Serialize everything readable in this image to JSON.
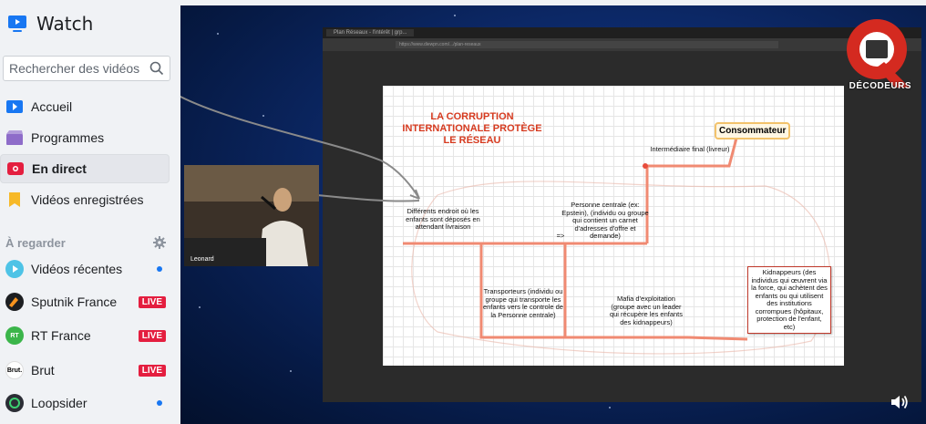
{
  "sidebar": {
    "title": "Watch",
    "search_placeholder": "Rechercher des vidéos",
    "nav": [
      {
        "label": "Accueil"
      },
      {
        "label": "Programmes"
      },
      {
        "label": "En direct"
      },
      {
        "label": "Vidéos enregistrées"
      }
    ],
    "section_label": "À regarder",
    "following": [
      {
        "label": "Vidéos récentes",
        "badge": ""
      },
      {
        "label": "Sputnik France",
        "badge": "LIVE"
      },
      {
        "label": "RT France",
        "badge": "LIVE"
      },
      {
        "label": "Brut",
        "badge": "LIVE"
      },
      {
        "label": "Loopsider",
        "badge": ""
      }
    ],
    "avatar_text": {
      "rt": "RT",
      "brut": "Brut."
    }
  },
  "video": {
    "browser_tab": "Plan Réseaux - l'intérêt | grp...",
    "url": "https://www.diewpn.com/.../plan-reseaux",
    "pip_label": "Leonard",
    "logo_text": "DÉCODEURS"
  },
  "mindmap": {
    "title_lines": [
      "LA CORRUPTION",
      "INTERNATIONALE PROTÈGE",
      "LE RÉSEAU"
    ],
    "consommateur": "Consommateur",
    "intermediaire": "Intermédiaire final (livreur)",
    "personne_centrale": "Personne centrale (ex: Epstein), (individu ou groupe qui contient un carnet d'adresses d'offre et demande)",
    "arrow": "=>",
    "differents": "Différents endroit où les enfants sont déposés en attendant livraison",
    "transporteurs": "Transporteurs (individu ou groupe qui transporte les enfants vers le controle de la Personne centrale)",
    "mafia": "Mafia d'exploitation (groupe avec un leader qui récupère les enfants des kidnappeurs)",
    "kidnappeurs": "Kidnappeurs (des individus qui œuvrent via la force, qui achètent des enfants ou qui utilisent des institutions corrompues (hôpitaux, protection de l'enfant, etc)"
  },
  "colors": {
    "live_red": "#e41e3f",
    "link_blue": "#1877f2",
    "mindmap_line": "#f08a72",
    "title_red": "#d63a1f"
  },
  "icons": [
    "tv-icon",
    "search-icon",
    "home-icon",
    "programs-icon",
    "live-icon",
    "saved-icon",
    "gear-icon",
    "volume-icon"
  ]
}
